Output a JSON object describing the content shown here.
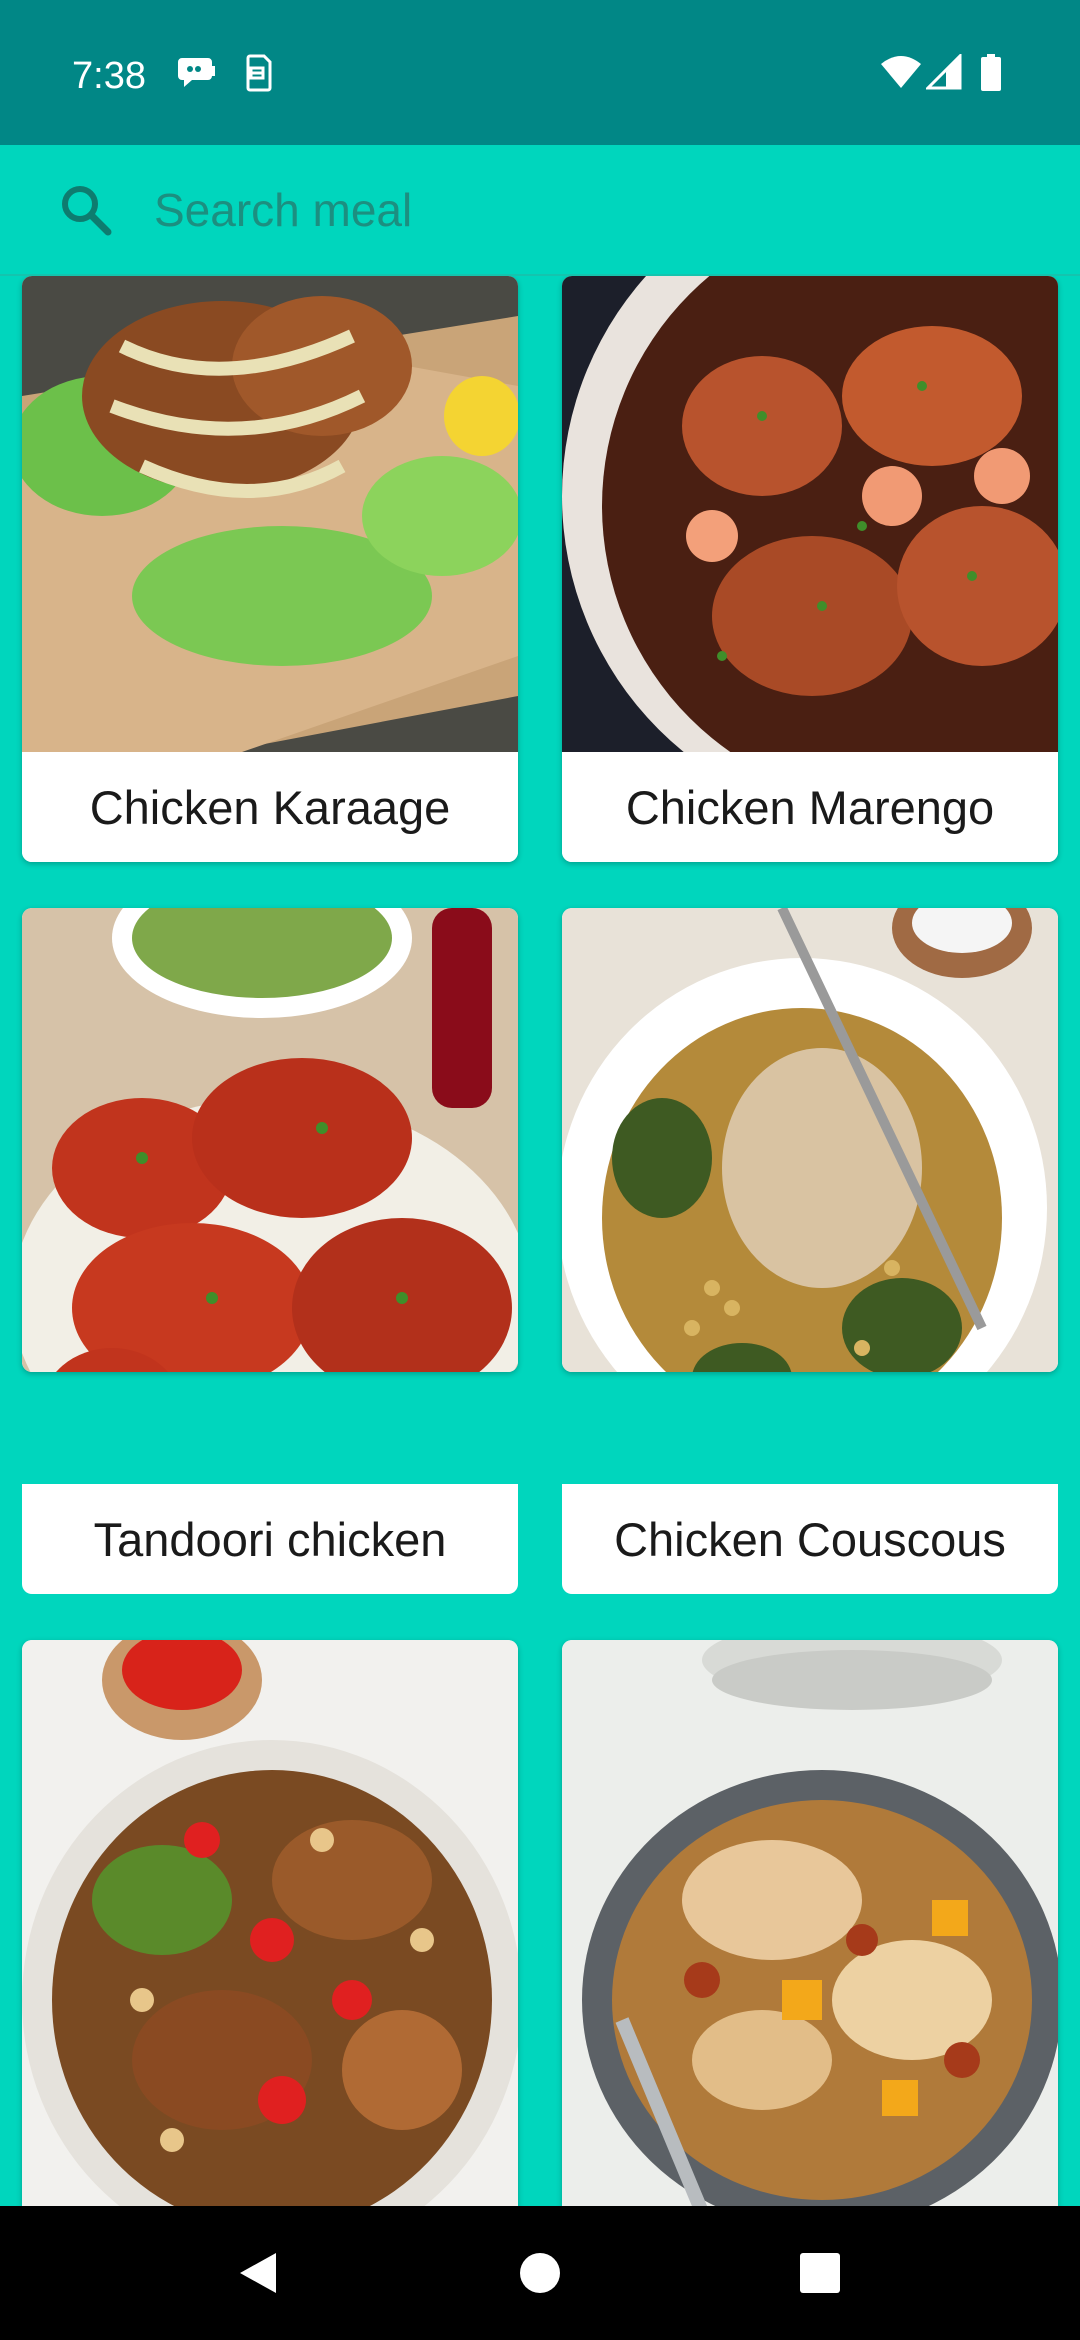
{
  "status_bar": {
    "time": "7:38",
    "left_icons": [
      "chat-bubble-icon",
      "sim-notification-icon"
    ],
    "right_icons": [
      "wifi-icon",
      "cellular-signal-icon",
      "battery-icon"
    ]
  },
  "search": {
    "placeholder": "Search meal",
    "value": "",
    "icon": "search-icon"
  },
  "colors": {
    "status_bar": "#018786",
    "background": "#00d6bd",
    "search_text": "#1c8f80",
    "card": "#ffffff",
    "nav_bar": "#000000"
  },
  "meals": [
    {
      "name": "Chicken Karaage"
    },
    {
      "name": "Chicken Marengo"
    },
    {
      "name": "Tandoori chicken"
    },
    {
      "name": "Chicken Couscous"
    },
    {
      "name": ""
    },
    {
      "name": ""
    }
  ],
  "nav_bar": {
    "buttons": [
      "back-icon",
      "home-icon",
      "recents-icon"
    ]
  }
}
